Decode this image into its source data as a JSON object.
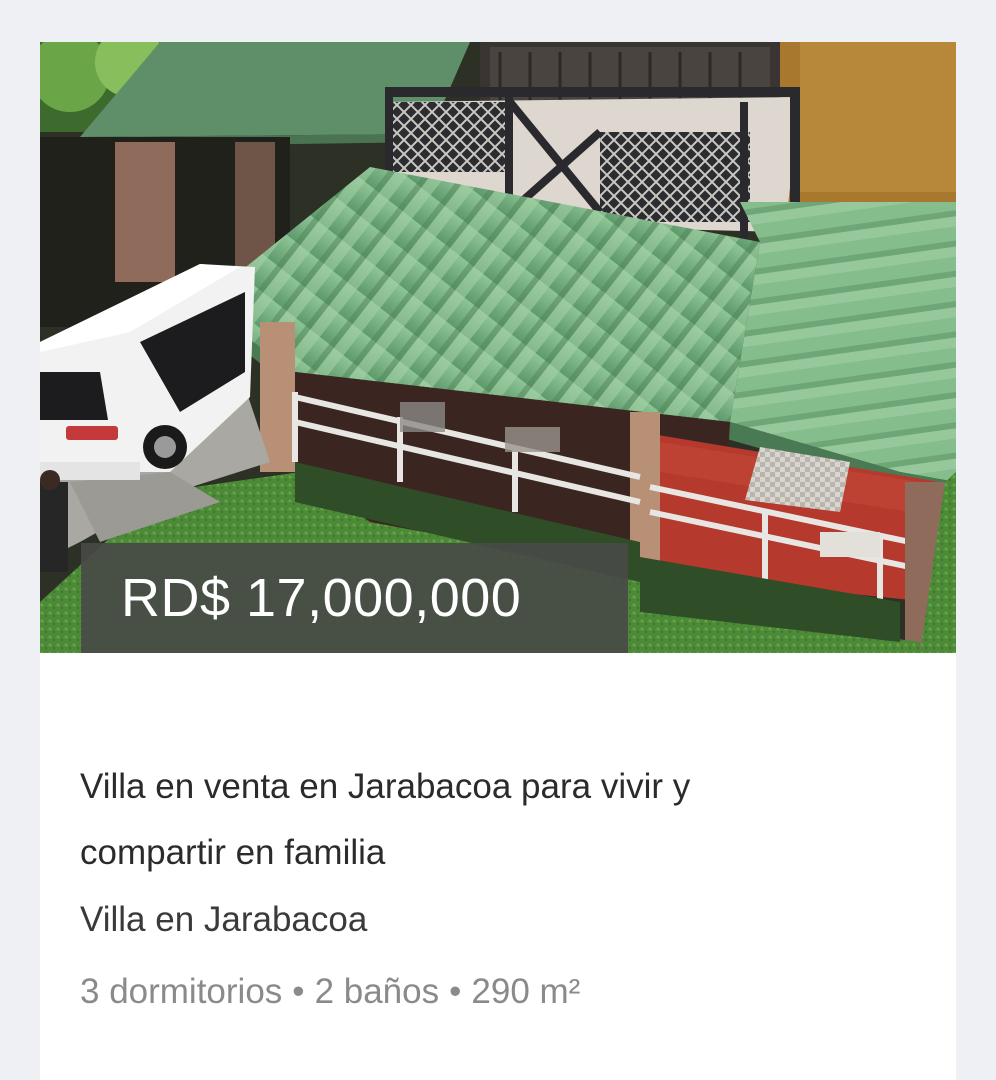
{
  "listing": {
    "price": "RD$ 17,000,000",
    "title": "Villa en venta en Jarabacoa para vivir y compartir en familia",
    "subtitle": "Villa en Jarabacoa",
    "features": {
      "bedrooms": "3 dormitorios",
      "bathrooms": "2 baños",
      "area": "290 m²",
      "separator": "•"
    }
  },
  "colors": {
    "page_background": "#eef0f3",
    "card_background": "#ffffff",
    "price_overlay": "#484a46",
    "roof_green": "#7fb887",
    "deck_red": "#b5392c"
  }
}
